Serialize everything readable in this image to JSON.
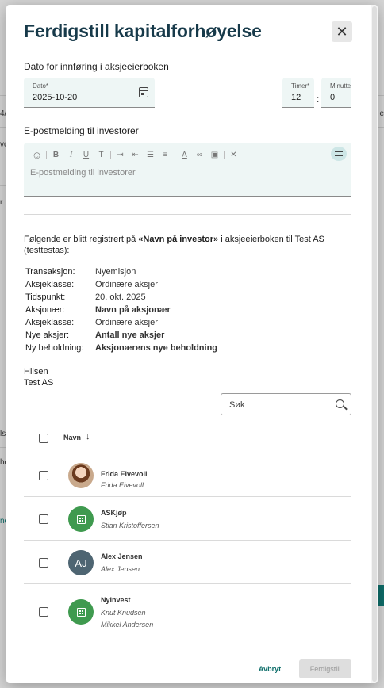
{
  "background": {
    "fragments_left": [
      "4/",
      "vo",
      "r",
      "lse",
      "he",
      "ne"
    ],
    "fragment_right": "e"
  },
  "modal": {
    "title": "Ferdigstill kapitalforhøyelse",
    "close_icon": "close-icon"
  },
  "date_section": {
    "label": "Dato for innføring i aksjeeierboken",
    "date_label": "Dato*",
    "date_value": "2025-10-20",
    "hours_label": "Timer*",
    "hours_value": "12",
    "minutes_label": "Minutte",
    "minutes_value": "0",
    "separator": ":"
  },
  "email_section": {
    "label": "E-postmelding til investorer",
    "placeholder": "E-postmelding til investorer",
    "toolbar": [
      {
        "name": "emoji-icon",
        "glyph": "☺"
      },
      {
        "name": "bold-icon",
        "glyph": "B"
      },
      {
        "name": "italic-icon",
        "glyph": "I"
      },
      {
        "name": "underline-icon",
        "glyph": "U"
      },
      {
        "name": "strikethrough-icon",
        "glyph": "T"
      },
      {
        "name": "indent-increase-icon",
        "glyph": "⇥"
      },
      {
        "name": "indent-decrease-icon",
        "glyph": "⇤"
      },
      {
        "name": "bulleted-list-icon",
        "glyph": "☰"
      },
      {
        "name": "numbered-list-icon",
        "glyph": "≡"
      },
      {
        "name": "font-color-icon",
        "glyph": "A"
      },
      {
        "name": "link-icon",
        "glyph": "∞"
      },
      {
        "name": "image-icon",
        "glyph": "▣"
      },
      {
        "name": "clear-format-icon",
        "glyph": "✕"
      }
    ],
    "active_tool_icon": "toolbar-toggle-icon"
  },
  "message": {
    "intro_prefix": "Følgende er blitt registrert på ",
    "intro_bold": "«Navn på investor»",
    "intro_suffix": " i aksjeeierboken til Test AS (testtestas):",
    "rows": [
      {
        "key": "Transaksjon:",
        "value": "Nyemisjon",
        "bold": false
      },
      {
        "key": "Aksjeklasse:",
        "value": "Ordinære aksjer",
        "bold": false
      },
      {
        "key": "Tidspunkt:",
        "value": "20. okt. 2025",
        "bold": false
      },
      {
        "key": "Aksjonær:",
        "value": "Navn på aksjonær",
        "bold": true
      },
      {
        "key": "Aksjeklasse:",
        "value": "Ordinære aksjer",
        "bold": false
      },
      {
        "key": "Nye aksjer:",
        "value": "Antall nye aksjer",
        "bold": true
      },
      {
        "key": "Ny beholdning:",
        "value": "Aksjonærens nye beholdning",
        "bold": true
      }
    ],
    "greeting": "Hilsen",
    "signature": "Test AS"
  },
  "search": {
    "placeholder": "Søk"
  },
  "table": {
    "column_name": "Navn",
    "rows": [
      {
        "name": "Frida Elvevoll",
        "sub": [
          "Frida Elvevoll"
        ],
        "avatar": "photo",
        "initials": ""
      },
      {
        "name": "ASKjøp",
        "sub": [
          "Stian Kristoffersen"
        ],
        "avatar": "company",
        "initials": ""
      },
      {
        "name": "Alex Jensen",
        "sub": [
          "Alex Jensen"
        ],
        "avatar": "initials",
        "initials": "AJ"
      },
      {
        "name": "NyInvest",
        "sub": [
          "Knut Knudsen",
          "Mikkel Andersen"
        ],
        "avatar": "company",
        "initials": ""
      }
    ]
  },
  "actions": {
    "cancel_label": "Avbryt",
    "finish_label": "Ferdigstill"
  },
  "colors": {
    "title": "#173a4a",
    "accent": "#0e6e6a",
    "field_bg": "#eef6f5",
    "avatar_green": "#3f9a4f",
    "avatar_slate": "#4e6572"
  }
}
